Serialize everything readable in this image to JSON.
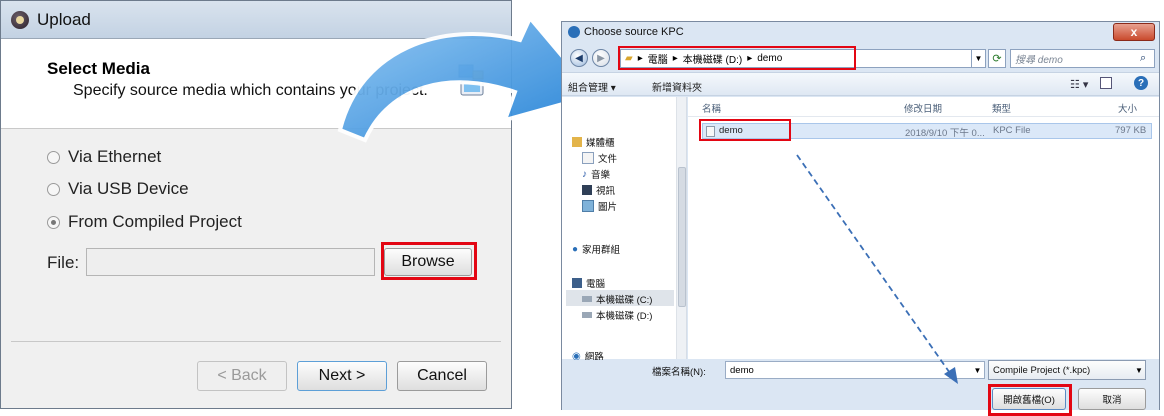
{
  "upload": {
    "title": "Upload",
    "header_title": "Select Media",
    "header_desc": "Specify source media which contains your project.",
    "options": [
      "Via Ethernet",
      "Via USB Device",
      "From Compiled Project"
    ],
    "selected_option": "From Compiled Project",
    "file_label": "File:",
    "file_value": "",
    "browse_label": "Browse",
    "back_label": "< Back",
    "next_label": "Next >",
    "cancel_label": "Cancel"
  },
  "dialog": {
    "title": "Choose source KPC",
    "close_label": "x",
    "breadcrumb": [
      "電腦",
      "本機磁碟 (D:)",
      "demo"
    ],
    "search_placeholder": "搜尋 demo",
    "toolbar": {
      "organize": "組合管理 ▾",
      "new_folder": "新增資料夾"
    },
    "nav_items": [
      {
        "label": "媒體櫃",
        "icon": "library-icon"
      },
      {
        "label": "文件",
        "icon": "document-icon"
      },
      {
        "label": "音樂",
        "icon": "music-icon"
      },
      {
        "label": "視訊",
        "icon": "video-icon"
      },
      {
        "label": "圖片",
        "icon": "picture-icon"
      },
      {
        "label": "家用群組",
        "icon": "homegroup-icon"
      },
      {
        "label": "電腦",
        "icon": "computer-icon"
      },
      {
        "label": "本機磁碟 (C:)",
        "icon": "drive-icon"
      },
      {
        "label": "本機磁碟 (D:)",
        "icon": "drive-icon"
      },
      {
        "label": "網路",
        "icon": "network-icon"
      }
    ],
    "columns": [
      "名稱",
      "修改日期",
      "類型",
      "大小"
    ],
    "files": [
      {
        "name": "demo",
        "modified": "2018/9/10 下午 0...",
        "type": "KPC File",
        "size": "797 KB"
      }
    ],
    "filename_label": "檔案名稱(N):",
    "filename_value": "demo",
    "filetype": "Compile Project (*.kpc)",
    "open_label": "開啟舊檔(O)",
    "cancel_label": "取消"
  },
  "colors": {
    "highlight": "#e30613",
    "arrow": "#3a8fd8",
    "dashed_arrow": "#3b6fb6"
  }
}
